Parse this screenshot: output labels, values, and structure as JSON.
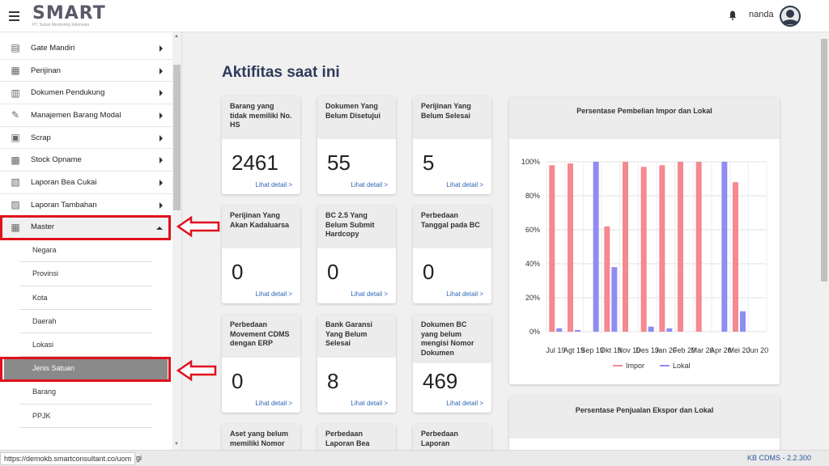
{
  "header": {
    "logo_text": "SMART",
    "logo_tag": "PT. Solusi Monitoring Indonesia",
    "username": "nanda"
  },
  "sidebar": {
    "items": [
      {
        "label": "Gate Mandiri",
        "icon": "gate-icon"
      },
      {
        "label": "Perijinan",
        "icon": "document-icon"
      },
      {
        "label": "Dokumen Pendukung",
        "icon": "book-icon"
      },
      {
        "label": "Manajemen Barang Modal",
        "icon": "tools-icon"
      },
      {
        "label": "Scrap",
        "icon": "trash-icon"
      },
      {
        "label": "Stock Opname",
        "icon": "boxes-icon"
      },
      {
        "label": "Laporan Bea Cukai",
        "icon": "report-icon"
      },
      {
        "label": "Laporan Tambahan",
        "icon": "report-plus-icon"
      },
      {
        "label": "Master",
        "icon": "database-icon"
      }
    ],
    "master_subitems": [
      "Negara",
      "Provinsi",
      "Kota",
      "Daerah",
      "Lokasi",
      "Jenis Satuan",
      "Barang",
      "PPJK"
    ]
  },
  "main": {
    "title": "Aktifitas saat ini",
    "link_label": "Lihat detail >",
    "cards": [
      {
        "title": "Barang yang tidak memiliki No. HS",
        "value": "2461"
      },
      {
        "title": "Dokumen Yang Belum Disetujui",
        "value": "55"
      },
      {
        "title": "Perijinan Yang Belum Selesai",
        "value": "5"
      },
      {
        "title": "Perijinan Yang Akan Kadaluarsa",
        "value": "0"
      },
      {
        "title": "BC 2.5 Yang Belum Submit Hardcopy",
        "value": "0"
      },
      {
        "title": "Perbedaan Tanggal pada BC",
        "value": "0"
      },
      {
        "title": "Perbedaan Movement CDMS dengan ERP",
        "value": "0"
      },
      {
        "title": "Bank Garansi Yang Belum Selesai",
        "value": "8"
      },
      {
        "title": "Dokumen BC yang belum mengisi Nomor Dokumen",
        "value": "469"
      },
      {
        "title": "Aset yang belum memiliki Nomor",
        "value": ""
      },
      {
        "title": "Perbedaan Laporan Bea",
        "value": ""
      },
      {
        "title": "Perbedaan Laporan",
        "value": ""
      }
    ],
    "panel2_title": "Persentase Penjualan Ekspor dan Lokal"
  },
  "chart_data": {
    "type": "bar",
    "title": "Persentase Pembelian Impor dan Lokal",
    "categories": [
      "Jul 19",
      "Agt 19",
      "Sep 19",
      "Okt 19",
      "Nov 19",
      "Des 19",
      "Jan 20",
      "Feb 20",
      "Mar 20",
      "Apr 20",
      "Mei 20",
      "Jun 20"
    ],
    "series": [
      {
        "name": "Impor",
        "color": "#f4898f",
        "values": [
          98,
          99,
          0,
          62,
          100,
          97,
          98,
          100,
          100,
          0,
          88,
          0
        ]
      },
      {
        "name": "Lokal",
        "color": "#8f8cf2",
        "values": [
          2,
          1,
          100,
          38,
          0,
          3,
          2,
          0,
          0,
          100,
          12,
          0
        ]
      }
    ],
    "yticks": [
      "0%",
      "20%",
      "40%",
      "60%",
      "80%",
      "100%"
    ],
    "ylim": [
      0,
      100
    ],
    "legend": "bottom",
    "grid": true
  },
  "statusbar": {
    "url": "https://demokb.smartconsultant.co/uom",
    "fragment": "gi",
    "version": "KB CDMS - 2.2.300"
  }
}
